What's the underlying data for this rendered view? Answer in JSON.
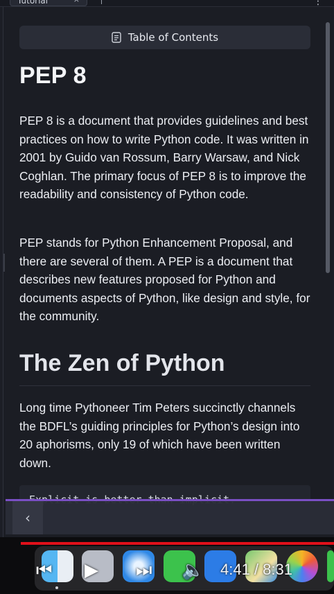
{
  "tab": {
    "title": "Tutorial",
    "close": "×"
  },
  "menu": {
    "kebab": "⋮"
  },
  "toc": {
    "label": "Table of Contents"
  },
  "article": {
    "h1": "PEP 8",
    "p1": "PEP 8 is a document that provides guidelines and best practices on how to write Python code. It was written in 2001 by Guido van Rossum, Barry Warsaw, and Nick Coghlan. The primary focus of PEP 8 is to improve the readability and consistency of Python code.",
    "p2": "PEP stands for Python Enhancement Proposal, and there are several of them. A PEP is a document that describes new features proposed for Python and documents aspects of Python, like design and style, for the community.",
    "h2": "The Zen of Python",
    "p3": "Long time Pythoneer Tim Peters succinctly channels the BDFL’s guiding principles for Python’s design into 20 aphorisms, only 19 of which have been written down.",
    "code_line1": "Explicit is better than implicit."
  },
  "panel": {
    "collapse_icon": "‹"
  },
  "video": {
    "prev": "⏮",
    "play": "▶",
    "next": "⏭",
    "volume": "🔈",
    "time": "4:41 / 8:31",
    "progress": 0.55
  },
  "colors": {
    "accent": "#7a4fc4",
    "progress": "#e0101a"
  }
}
